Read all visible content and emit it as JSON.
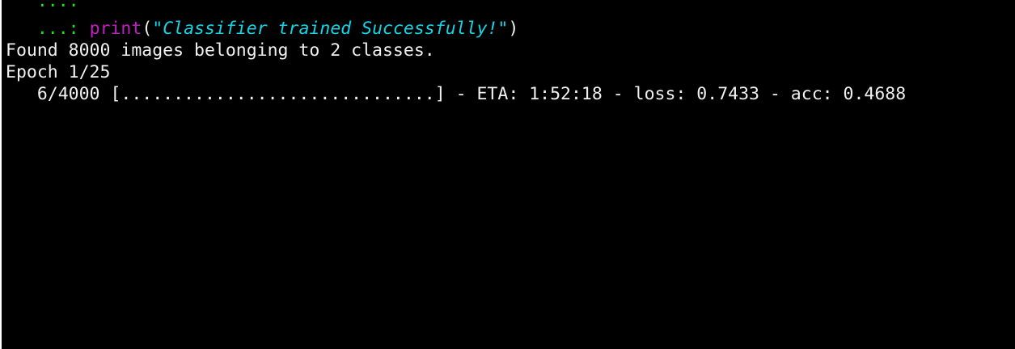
{
  "terminal": {
    "lines": [
      {
        "indent": "   ",
        "prompt": "...:"
      },
      {
        "indent": "   ",
        "prompt": "...:",
        "func": "print",
        "open": "(",
        "string": "\"Classifier trained Successfully!\"",
        "close": ")"
      },
      {
        "text": "Found 8000 images belonging to 2 classes."
      },
      {
        "text": "Epoch 1/25"
      },
      {
        "text": "   6/4000 [..............................] - ETA: 1:52:18 - loss: 0.7433 - acc: 0.4688"
      }
    ]
  },
  "colors": {
    "background": "#000000",
    "text": "#f0f0f0",
    "continuation_prompt": "#1ee01e",
    "builtin_function": "#c21ec2",
    "string_literal": "#12d6e8"
  }
}
